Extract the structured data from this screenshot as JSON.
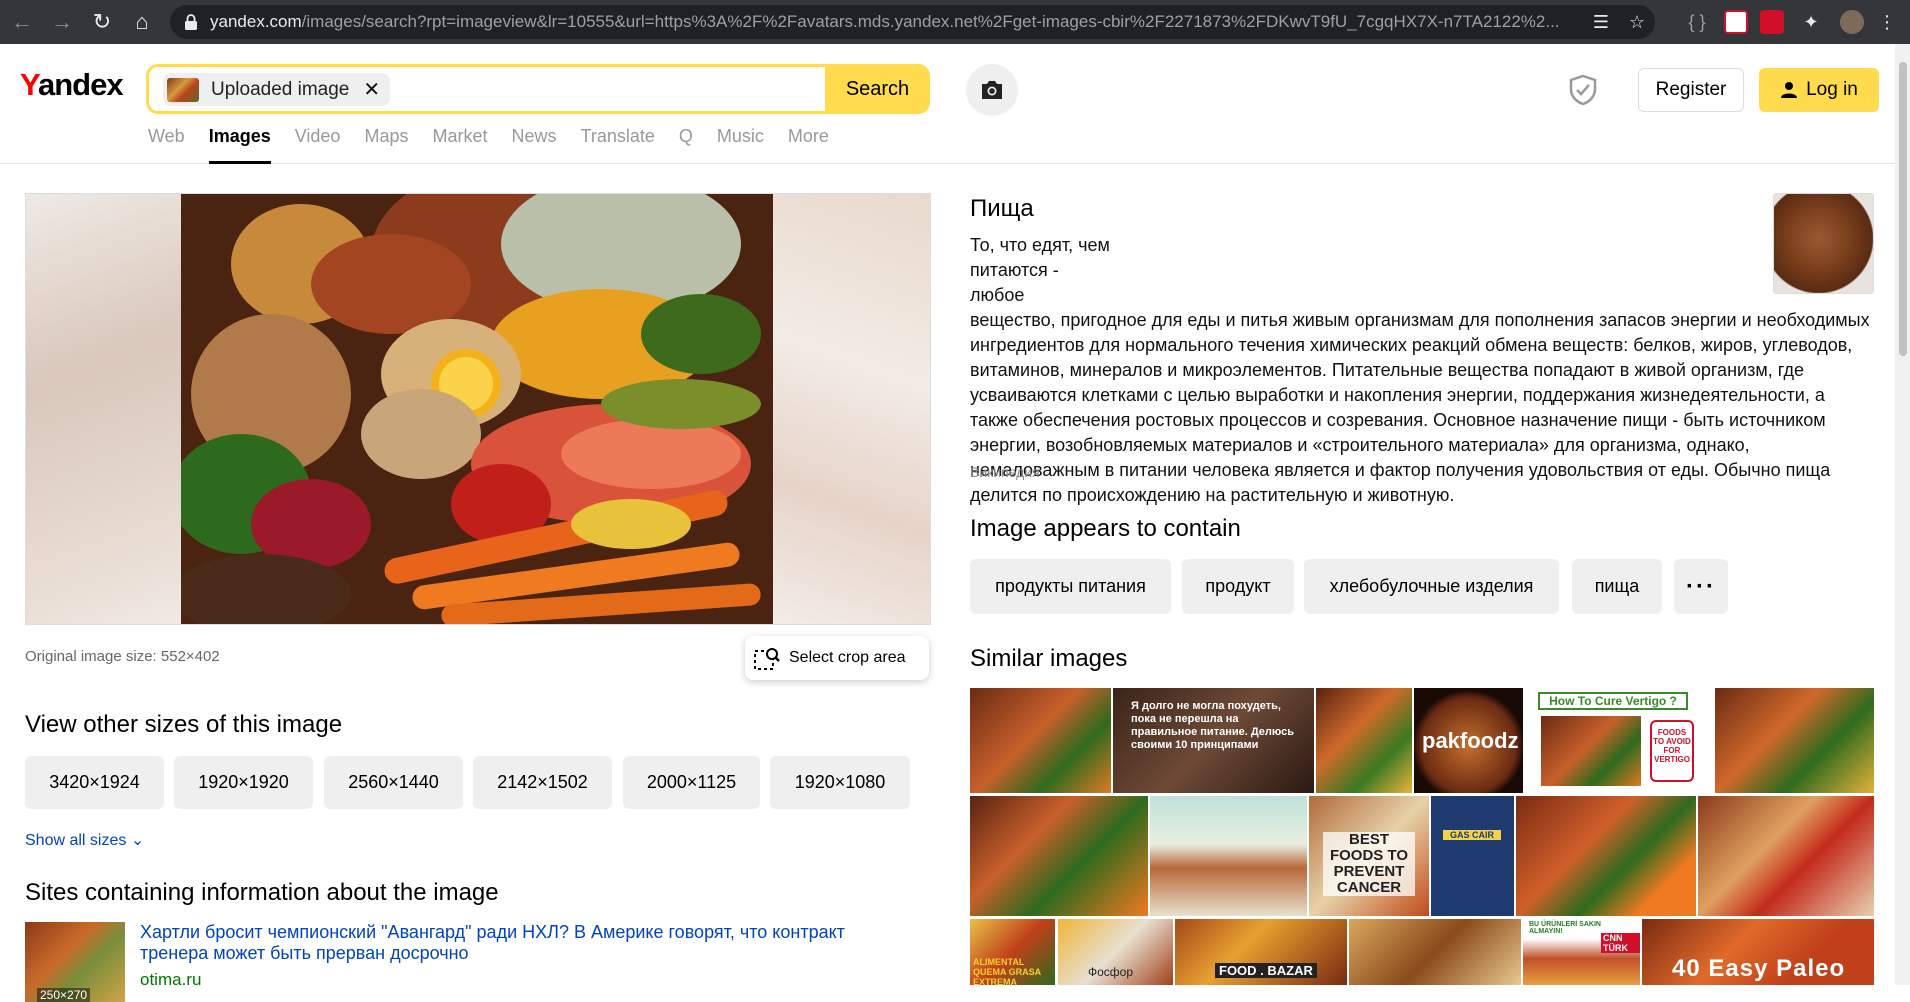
{
  "browser": {
    "url_host": "yandex.com",
    "url_path": "/images/search?rpt=imageview&lr=10555&url=https%3A%2F%2Favatars.mds.yandex.net%2Fget-images-cbir%2F2271873%2FDKwvT9fU_7cgqHX7X-n7TA2122%2..."
  },
  "header": {
    "logo_first": "Y",
    "logo_rest": "andex",
    "search_chip_label": "Uploaded image",
    "search_button": "Search",
    "register": "Register",
    "login": "Log in",
    "tabs": [
      "Web",
      "Images",
      "Video",
      "Maps",
      "Market",
      "News",
      "Translate",
      "Q",
      "Music",
      "More"
    ],
    "active_tab": "Images"
  },
  "left": {
    "original_size": "Original image size: 552×402",
    "crop_button": "Select crop area",
    "other_sizes_heading": "View other sizes of this image",
    "sizes": [
      "3420×1924",
      "1920×1920",
      "2560×1440",
      "2142×1502",
      "2000×1125",
      "1920×1080"
    ],
    "show_all": "Show all sizes",
    "sites_heading": "Sites containing information about the image",
    "site_title": "Хартли бросит чемпионский \"Авангард\" ради НХЛ? В Америке говорят, что контракт тренера может быть прерван досрочно",
    "site_domain": "otima.ru",
    "site_thumb_size": "250×270"
  },
  "right": {
    "wiki_title": "Пища",
    "wiki_text": "То, что едят, чем питаются - любое вещество, пригодное для еды и питья живым организмам для пополнения запасов энергии и необходимых ингредиентов для нормального течения химических реакций обмена веществ: белков, жиров, углеводов, витаминов, минералов и микроэлементов. Питательные вещества попадают в живой организм, где усваиваются клетками с целью выработки и накопления энергии, поддержания жизнедеятельности, а также обеспечения ростовых процессов и созревания. Основное назначение пищи - быть источником энергии, возобновляемых материалов и «строительного материала» для организма, однако, немаловажным в питании человека является и фактор получения удовольствия от еды. Обычно пища делится по происхождению на растительную и животную.",
    "wiki_source": "Википедия",
    "contains_heading": "Image appears to contain",
    "tags": [
      "продукты питания",
      "продукт",
      "хлебобулочные изделия",
      "пища"
    ],
    "similar_heading": "Similar images",
    "similar_texts": {
      "t2": "Я долго не могла похудеть, пока не перешла на правильное питание. Делюсь своими 10 принципами",
      "t4": "pakfoodz",
      "t5": "How To Cure Vertigo ?",
      "t5b": "FOODS TO AVOID FOR VERTIGO",
      "t9": "BEST FOODS TO PREVENT CANCER",
      "t10": "GAS CAIR",
      "t13": "ALIMENTAL QUEMA GRASA EXTREMA",
      "t14": "Фосфор",
      "t15": "FOOD . BAZAR",
      "t17": "BU ÜRÜNLERİ SAKIN ALMAYIN!",
      "t17b": "CNN TÜRK",
      "t18": "40 Easy Paleo"
    }
  },
  "colors": {
    "yandex_yellow": "#ffdb4d",
    "link_blue": "#0044bb",
    "domain_green": "#007700",
    "chrome_dark": "#35363a"
  }
}
